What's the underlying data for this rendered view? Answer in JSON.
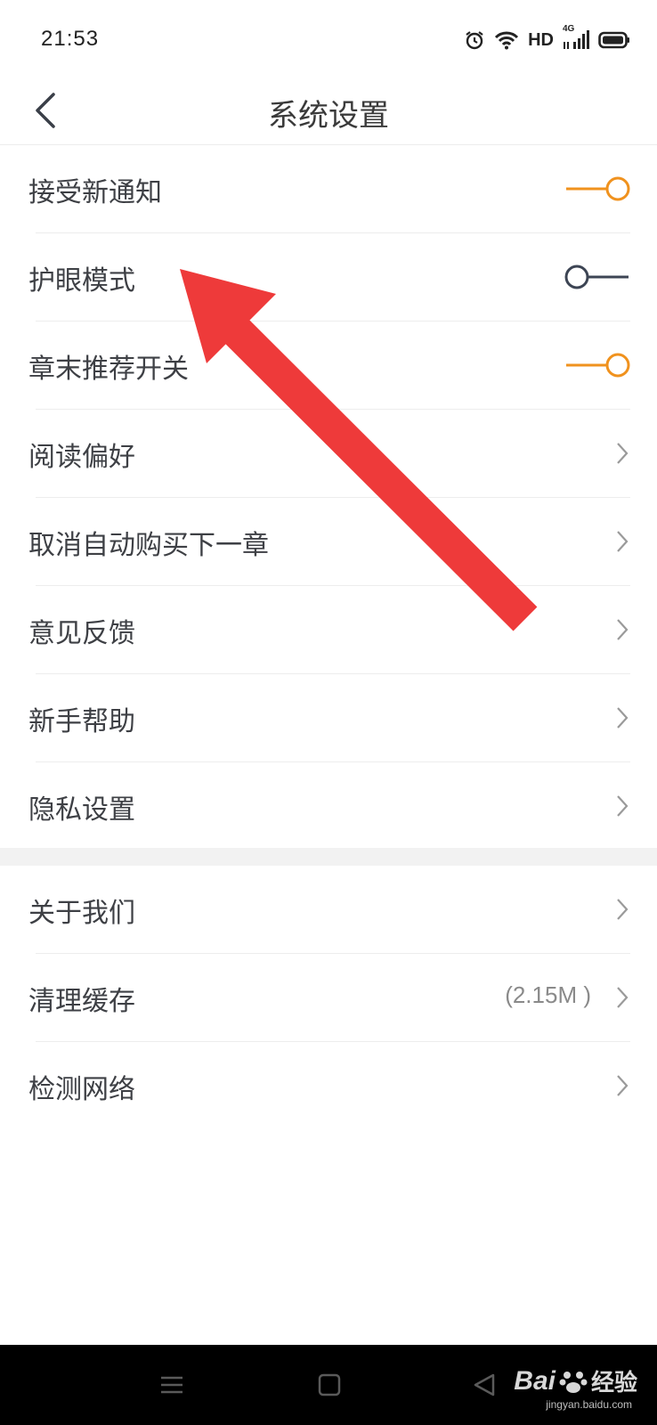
{
  "status_bar": {
    "time": "21:53",
    "network_label": "HD",
    "network_type": "4G",
    "icons": [
      "alarm-icon",
      "wifi-icon",
      "signal-icon",
      "battery-icon"
    ]
  },
  "header": {
    "title": "系统设置",
    "back_icon": "chevron-left-icon"
  },
  "settings_group_1": [
    {
      "label": "接受新通知",
      "control": "toggle",
      "on": true
    },
    {
      "label": "护眼模式",
      "control": "toggle",
      "on": false
    },
    {
      "label": "章末推荐开关",
      "control": "toggle",
      "on": true
    },
    {
      "label": "阅读偏好",
      "control": "chevron"
    },
    {
      "label": "取消自动购买下一章",
      "control": "chevron"
    },
    {
      "label": "意见反馈",
      "control": "chevron"
    },
    {
      "label": "新手帮助",
      "control": "chevron"
    },
    {
      "label": "隐私设置",
      "control": "chevron"
    }
  ],
  "settings_group_2": [
    {
      "label": "关于我们",
      "control": "chevron"
    },
    {
      "label": "清理缓存",
      "control": "chevron",
      "value": "(2.15M )"
    },
    {
      "label": "检测网络",
      "control": "chevron"
    }
  ],
  "colors": {
    "toggle_on": "#f0921e",
    "toggle_off": "#3d4554",
    "annotation_arrow": "#ee3a3a",
    "nav_bar": "#000000"
  },
  "nav_bar": {
    "buttons": [
      "menu-icon",
      "home-icon",
      "back-triangle-icon"
    ]
  },
  "watermark": {
    "brand": "Bai",
    "brand_suffix": "经验",
    "url": "jingyan.baidu.com"
  }
}
